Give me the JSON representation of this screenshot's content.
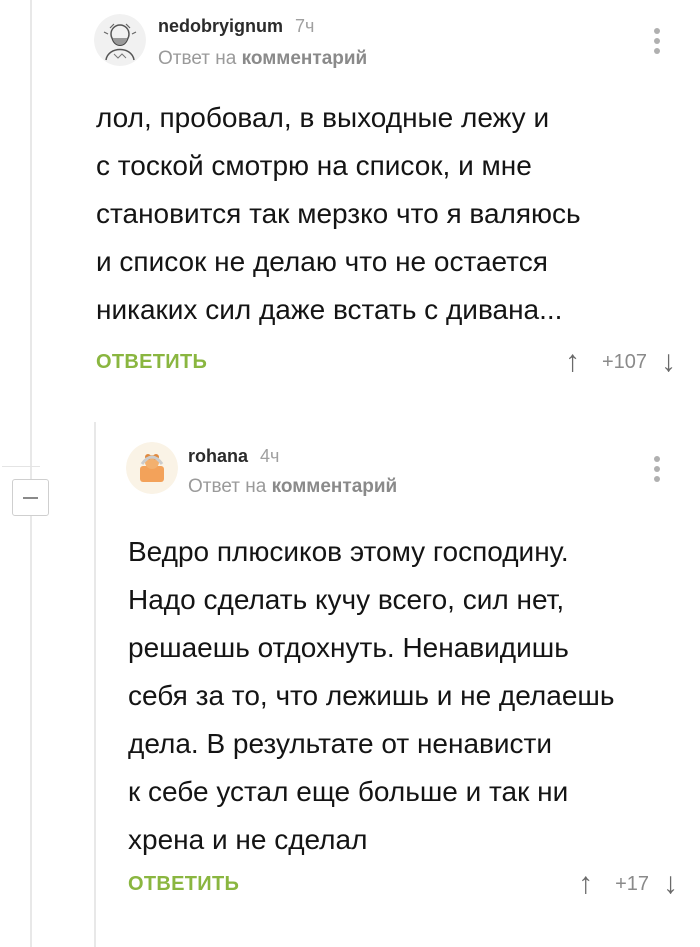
{
  "comments": [
    {
      "author": "nedobryignum",
      "time": "7ч",
      "reply_prefix": "Ответ на ",
      "reply_target": "комментарий",
      "text": "лол, пробовал, в выходные лежу и\nс тоской смотрю на список, и мне\nстановится так мерзко что я валяюсь\nи список не делаю что не остается\nникаких сил даже встать с дивана...",
      "reply_label": "ОТВЕТИТЬ",
      "rating": "+107",
      "avatar_icon": "user-avatar-bearded-man-sketch"
    },
    {
      "author": "rohana",
      "time": "4ч",
      "reply_prefix": "Ответ на ",
      "reply_target": "комментарий",
      "text": "Ведро плюсиков этому господину.\nНадо сделать кучу всего, сил нет,\nрешаешь отдохнуть. Ненавидишь\nсебя за то, что лежишь и не делаешь\nдела. В результате от ненависти\nк себе устал еще больше и так ни\nхрена и не сделал",
      "reply_label": "ОТВЕТИТЬ",
      "rating": "+17",
      "avatar_icon": "user-avatar-orange-bear"
    }
  ],
  "icons": {
    "upvote": "↑",
    "downvote": "↓",
    "collapse": "minus-icon",
    "more": "kebab-menu-icon"
  },
  "colors": {
    "reply_green": "#8ab640",
    "meta_gray": "#9a9a9a"
  }
}
